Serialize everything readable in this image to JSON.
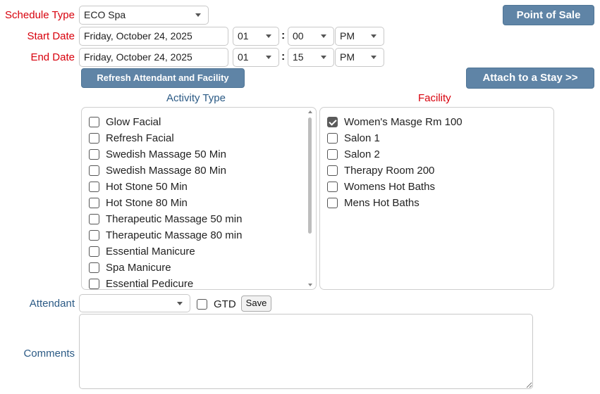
{
  "form": {
    "schedule_type_label": "Schedule Type",
    "schedule_type_value": "ECO Spa",
    "start_date_label": "Start Date",
    "start_date_value": "Friday, October 24, 2025",
    "start_hour": "01",
    "start_minute": "00",
    "start_ampm": "PM",
    "end_date_label": "End Date",
    "end_date_value": "Friday, October 24, 2025",
    "end_hour": "01",
    "end_minute": "15",
    "end_ampm": "PM",
    "colon": ":",
    "attendant_label": "Attendant",
    "attendant_value": "",
    "gtd_label": "GTD",
    "save_label": "Save",
    "comments_label": "Comments",
    "comments_value": ""
  },
  "buttons": {
    "point_of_sale": "Point of Sale",
    "refresh": "Refresh Attendant and Facility",
    "attach_stay": "Attach to a Stay >>"
  },
  "activity": {
    "header": "Activity Type",
    "items": [
      {
        "label": "Glow Facial",
        "checked": false
      },
      {
        "label": "Refresh Facial",
        "checked": false
      },
      {
        "label": "Swedish Massage 50 Min",
        "checked": false
      },
      {
        "label": "Swedish Massage 80 Min",
        "checked": false
      },
      {
        "label": "Hot Stone 50 Min",
        "checked": false
      },
      {
        "label": "Hot Stone 80 Min",
        "checked": false
      },
      {
        "label": "Therapeutic Massage 50 min",
        "checked": false
      },
      {
        "label": "Therapeutic Massage 80 min",
        "checked": false
      },
      {
        "label": "Essential Manicure",
        "checked": false
      },
      {
        "label": "Spa Manicure",
        "checked": false
      },
      {
        "label": "Essential Pedicure",
        "checked": false
      }
    ]
  },
  "facility": {
    "header": "Facility",
    "items": [
      {
        "label": "Women's Masge Rm 100",
        "checked": true
      },
      {
        "label": "Salon 1",
        "checked": false
      },
      {
        "label": "Salon 2",
        "checked": false
      },
      {
        "label": "Therapy Room 200",
        "checked": false
      },
      {
        "label": "Womens Hot Baths",
        "checked": false
      },
      {
        "label": "Mens Hot Baths",
        "checked": false
      }
    ]
  },
  "colors": {
    "label_red": "#d8000c",
    "label_blue": "#2b5a85",
    "button_bg": "#5f84a6"
  }
}
